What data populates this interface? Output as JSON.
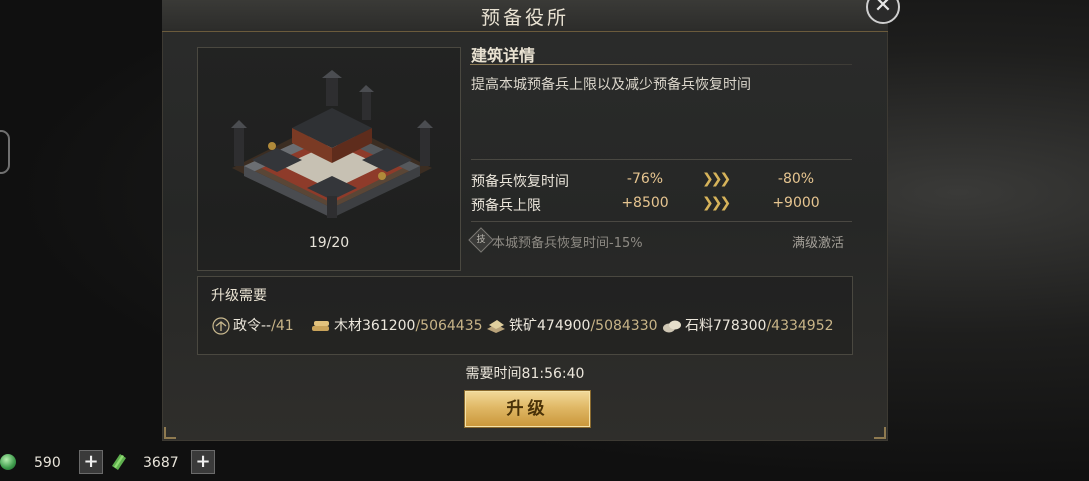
{
  "window": {
    "title": "预备役所",
    "close_glyph": "✕"
  },
  "building": {
    "level": "19/20"
  },
  "details": {
    "heading": "建筑详情",
    "description": "提高本城预备兵上限以及减少预备兵恢复时间",
    "stats": [
      {
        "label": "预备兵恢复时间",
        "current": "-76%",
        "next": "-80%"
      },
      {
        "label": "预备兵上限",
        "current": "+8500",
        "next": "+9000"
      }
    ],
    "arrow_glyph": "❯❯❯",
    "bonus": {
      "icon_char": "技",
      "text": "本城预备兵恢复时间-15%",
      "status": "满级激活"
    }
  },
  "requirements": {
    "heading": "升级需要",
    "items": [
      {
        "icon": "decree-icon",
        "label": "政令",
        "have": "--",
        "need": "/41"
      },
      {
        "icon": "wood-icon",
        "label": "木材",
        "have": "361200",
        "need": "/5064435"
      },
      {
        "icon": "iron-icon",
        "label": "铁矿",
        "have": "474900",
        "need": "/5084330"
      },
      {
        "icon": "stone-icon",
        "label": "石料",
        "have": "778300",
        "need": "/4334952"
      }
    ]
  },
  "time": {
    "label": "需要时间",
    "value": "81:56:40"
  },
  "upgrade_button": {
    "label": "升级"
  },
  "currency": {
    "jade": {
      "value": "590",
      "plus": "+"
    },
    "money": {
      "value": "3687",
      "plus": "+"
    }
  },
  "colors": {
    "accent_gold": "#e0b866",
    "value_orange": "#e6c590",
    "jade_green": "#3c9a4a"
  }
}
